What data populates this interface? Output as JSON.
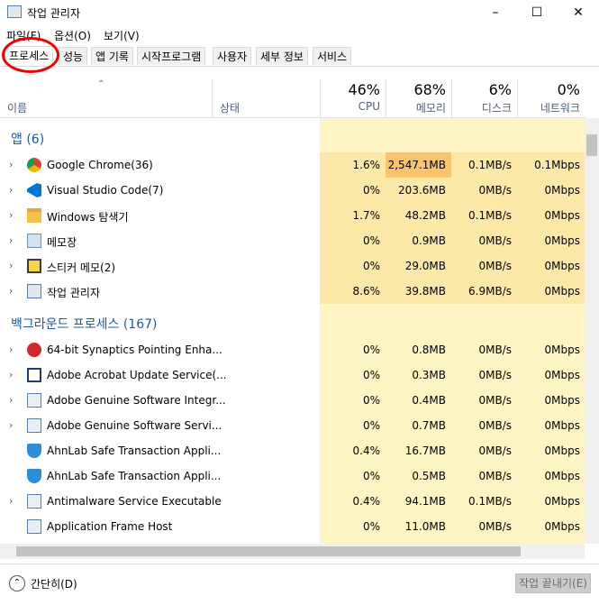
{
  "window": {
    "title": "작업 관리자"
  },
  "menu": [
    "파일(F)",
    "옵션(O)",
    "보기(V)"
  ],
  "tabs": [
    "프로세스",
    "성능",
    "앱 기록",
    "시작프로그램",
    "사용자",
    "세부 정보",
    "서비스"
  ],
  "header": {
    "name_label": "이름",
    "status_label": "상태",
    "cpu": {
      "pct": "46%",
      "label": "CPU"
    },
    "memory": {
      "pct": "68%",
      "label": "메모리"
    },
    "disk": {
      "pct": "6%",
      "label": "디스크"
    },
    "network": {
      "pct": "0%",
      "label": "네트워크"
    }
  },
  "groups": {
    "apps": "앱 (6)",
    "background": "백그라운드 프로세스 (167)"
  },
  "apps": [
    {
      "name": "Google Chrome(36)",
      "cpu": "1.6%",
      "memory": "2,547.1MB",
      "disk": "0.1MB/s",
      "network": "0.1Mbps",
      "icon": "chrome-icon",
      "expand": true
    },
    {
      "name": "Visual Studio Code(7)",
      "cpu": "0%",
      "memory": "203.6MB",
      "disk": "0MB/s",
      "network": "0Mbps",
      "icon": "vscode-icon",
      "expand": true
    },
    {
      "name": "Windows 탐색기",
      "cpu": "1.7%",
      "memory": "48.2MB",
      "disk": "0.1MB/s",
      "network": "0Mbps",
      "icon": "folder-icon",
      "expand": true
    },
    {
      "name": "메모장",
      "cpu": "0%",
      "memory": "0.9MB",
      "disk": "0MB/s",
      "network": "0Mbps",
      "icon": "notepad-icon",
      "expand": true
    },
    {
      "name": "스티커 메모(2)",
      "cpu": "0%",
      "memory": "29.0MB",
      "disk": "0MB/s",
      "network": "0Mbps",
      "icon": "sticky-notes-icon",
      "expand": true
    },
    {
      "name": "작업 관리자",
      "cpu": "8.6%",
      "memory": "39.8MB",
      "disk": "6.9MB/s",
      "network": "0Mbps",
      "icon": "task-manager-icon",
      "expand": true
    }
  ],
  "background": [
    {
      "name": "64-bit Synaptics Pointing Enha...",
      "cpu": "0%",
      "memory": "0.8MB",
      "disk": "0MB/s",
      "network": "0Mbps",
      "icon": "synaptics-icon",
      "expand": true
    },
    {
      "name": "Adobe Acrobat Update Service(...",
      "cpu": "0%",
      "memory": "0.3MB",
      "disk": "0MB/s",
      "network": "0Mbps",
      "icon": "window-app-icon",
      "expand": true
    },
    {
      "name": "Adobe Genuine Software Integr...",
      "cpu": "0%",
      "memory": "0.4MB",
      "disk": "0MB/s",
      "network": "0Mbps",
      "icon": "service-icon",
      "expand": true
    },
    {
      "name": "Adobe Genuine Software Servi...",
      "cpu": "0%",
      "memory": "0.7MB",
      "disk": "0MB/s",
      "network": "0Mbps",
      "icon": "service-icon",
      "expand": true
    },
    {
      "name": "AhnLab Safe Transaction Appli...",
      "cpu": "0.4%",
      "memory": "16.7MB",
      "disk": "0MB/s",
      "network": "0Mbps",
      "icon": "shield-icon",
      "expand": false
    },
    {
      "name": "AhnLab Safe Transaction Appli...",
      "cpu": "0%",
      "memory": "0.5MB",
      "disk": "0MB/s",
      "network": "0Mbps",
      "icon": "shield-icon",
      "expand": false
    },
    {
      "name": "Antimalware Service Executable",
      "cpu": "0.4%",
      "memory": "94.1MB",
      "disk": "0.1MB/s",
      "network": "0Mbps",
      "icon": "service-icon",
      "expand": true
    },
    {
      "name": "Application Frame Host",
      "cpu": "0%",
      "memory": "11.0MB",
      "disk": "0MB/s",
      "network": "0Mbps",
      "icon": "service-icon",
      "expand": false
    }
  ],
  "footer": {
    "fewer_details": "간단히(D)",
    "end_task": "작업 끝내기(E)"
  },
  "colors": {
    "heat_light": "#fff4c4",
    "heat_mid": "#fce9a7",
    "heat_high": "#f9c46b",
    "group": "#1c5aa8"
  }
}
